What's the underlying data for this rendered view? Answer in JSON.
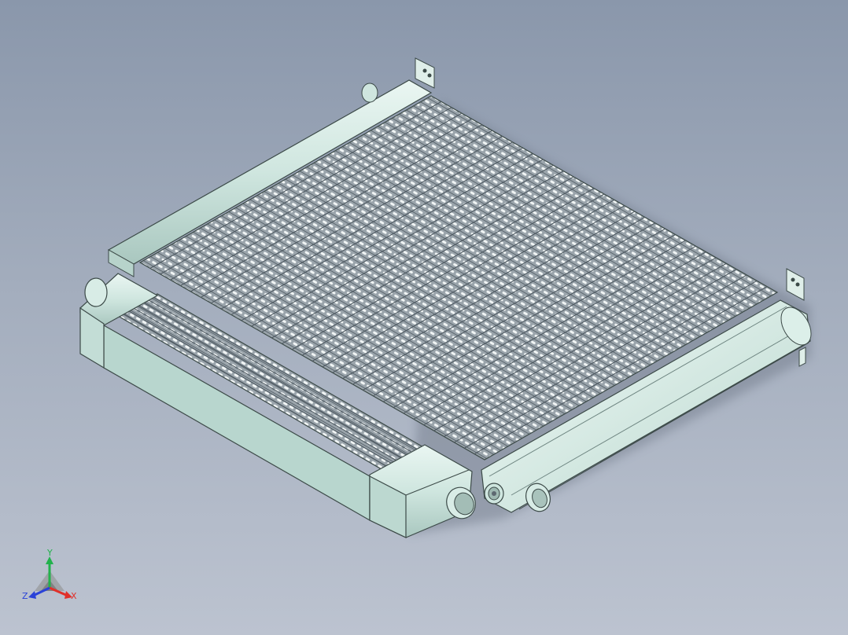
{
  "viewport": {
    "background_top": "#8a97ab",
    "background_bottom": "#bcc3d0"
  },
  "model": {
    "icon": "radiator-assembly-icon",
    "tank_color": "#cfe8e0",
    "tank_edge": "#3c4a48",
    "fin_color": "#8f9aa1",
    "fin_hole": "#f3f6f6"
  },
  "triad": {
    "icon": "coordinate-triad-icon",
    "x_label": "X",
    "y_label": "Y",
    "z_label": "Z",
    "x_color": "#e0302a",
    "y_color": "#22b24c",
    "z_color": "#2a42d8"
  }
}
